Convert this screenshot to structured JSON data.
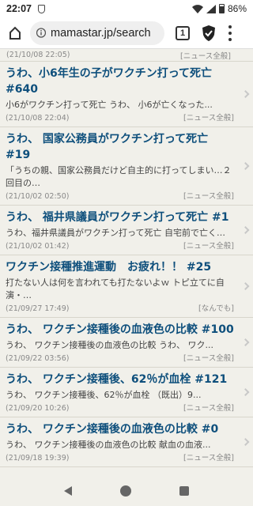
{
  "status": {
    "time": "22:07",
    "battery": "86%"
  },
  "browser": {
    "url": "mamastar.jp/search",
    "tab_count": "1"
  },
  "top_meta": {
    "date": "(21/10/08 22:05)",
    "category": "[ニュース全般]"
  },
  "items": [
    {
      "title": "うわ、小6年生の子がワクチン打って死亡 #640",
      "excerpt": "小6がワクチン打って死亡 うわ、 小6が亡くなった...",
      "date": "(21/10/08 22:04)",
      "category": "[ニュース全般]"
    },
    {
      "title": "うわ、 国家公務員がワクチン打って死亡 #19",
      "excerpt": "「うちの親、国家公務員だけど自主的に打ってしまい…２回目の…",
      "date": "(21/10/02 02:50)",
      "category": "[ニュース全般]"
    },
    {
      "title": "うわ、 福井県議員がワクチン打って死亡 #1",
      "excerpt": "うわ、福井県議員がワクチン打って死亡 自宅前で亡く…",
      "date": "(21/10/02 01:42)",
      "category": "[ニュース全般]"
    },
    {
      "title": "ワクチン接種推進運動　お疲れ！！ #25",
      "excerpt": "打たない人は何を言われても打たないよｗ トピ立てに自演・…",
      "date": "(21/09/27 17:49)",
      "category": "[なんでも]"
    },
    {
      "title": "うわ、 ワクチン接種後の血液色の比較 #100",
      "excerpt": "うわ、 ワクチン接種後の血液色の比較 うわ、 ワク...",
      "date": "(21/09/22 03:56)",
      "category": "[ニュース全般]"
    },
    {
      "title": "うわ、 ワクチン接種後、62％が血栓 #121",
      "excerpt": "うわ、 ワクチン接種後、62％が血栓 （既出）9...",
      "date": "(21/09/20 10:26)",
      "category": "[ニュース全般]"
    },
    {
      "title": "うわ、 ワクチン接種後の血液色の比較 #0",
      "excerpt": "うわ、 ワクチン接種後の血液色の比較 献血の血液...",
      "date": "(21/09/18 19:39)",
      "category": "[ニュース全般]"
    }
  ]
}
